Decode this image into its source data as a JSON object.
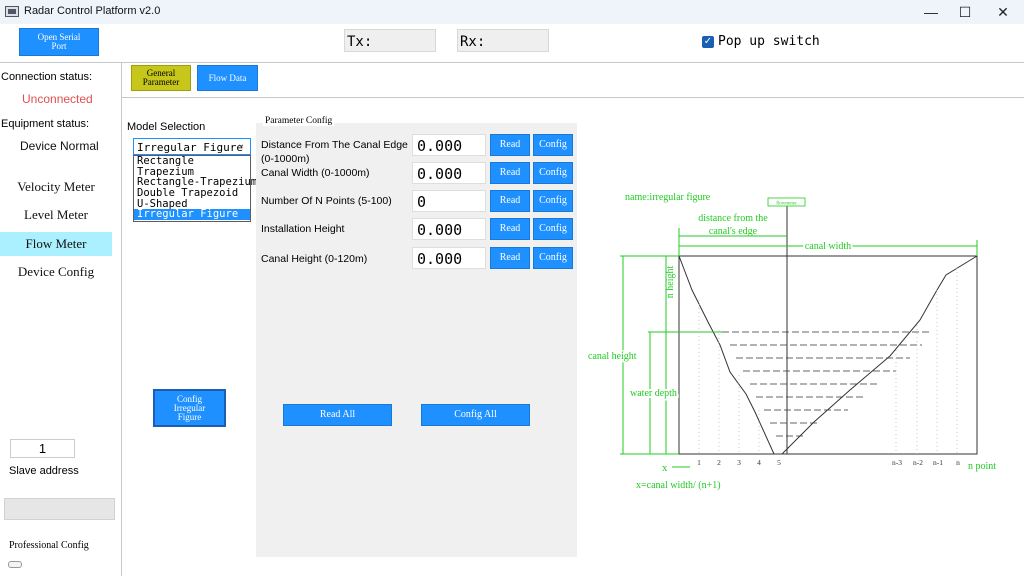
{
  "window": {
    "title": "Radar Control Platform v2.0",
    "minimize_glyph": "—",
    "maximize_glyph": "☐",
    "close_glyph": "✕"
  },
  "toolbar": {
    "open_serial_port": "Open Serial Port",
    "tx_label": "Tx:",
    "rx_label": "Rx:",
    "popup_switch_label": "Pop up switch",
    "popup_switch_checked": true
  },
  "tabs": [
    {
      "label": "General Parameter",
      "active": true
    },
    {
      "label": "Flow Data",
      "active": false
    }
  ],
  "sidebar": {
    "connection_status_label": "Connection status:",
    "connection_status_value": "Unconnected",
    "equipment_status_label": "Equipment status:",
    "equipment_status_value": "Device Normal",
    "nav_items": [
      {
        "label": "Velocity Meter",
        "active": false
      },
      {
        "label": "Level Meter",
        "active": false
      },
      {
        "label": "Flow Meter",
        "active": true
      },
      {
        "label": "Device Config",
        "active": false
      }
    ],
    "slave_address_value": "1",
    "slave_address_label": "Slave address",
    "professional_config_label": "Professional Config"
  },
  "model_selection": {
    "label": "Model Selection",
    "selected": "Irregular Figure",
    "options": [
      "Rectangle",
      "Trapezium",
      "Rectangle-Trapezium",
      "Double Trapezoid",
      "U-Shaped",
      "Irregular Figure"
    ],
    "config_button": "Config Irregular Figure"
  },
  "parameter_config": {
    "title": "Parameter Config",
    "read_label": "Read",
    "config_label": "Config",
    "rows": [
      {
        "label": "Distance From The Canal Edge (0-1000m)",
        "value": "0.000"
      },
      {
        "label": "Canal Width (0-1000m)",
        "value": "0.000"
      },
      {
        "label": "Number Of N Points (5-100)",
        "value": "0"
      },
      {
        "label": "Installation Height",
        "value": "0.000"
      },
      {
        "label": "Canal Height (0-120m)",
        "value": "0.000"
      }
    ],
    "read_all": "Read All",
    "config_all": "Config All"
  },
  "diagram": {
    "name_label": "name:irregular figure",
    "distance_label_1": "distance from the",
    "distance_label_2": "canal's edge",
    "flowmeter_tag": "flowmeter",
    "canal_width_label": "canal width",
    "n_height_label": "n height",
    "canal_height_label": "canal height",
    "water_depth_label": "water depth",
    "x_label": "x",
    "point_ticks": [
      "1",
      "2",
      "3",
      "4",
      "5",
      "n-3",
      "n-2",
      "n-1",
      "n"
    ],
    "n_point_label": "n point",
    "x_formula": "x=canal width/ (n+1)",
    "colors": {
      "annotation": "#22cc22",
      "outline": "#333333"
    }
  }
}
